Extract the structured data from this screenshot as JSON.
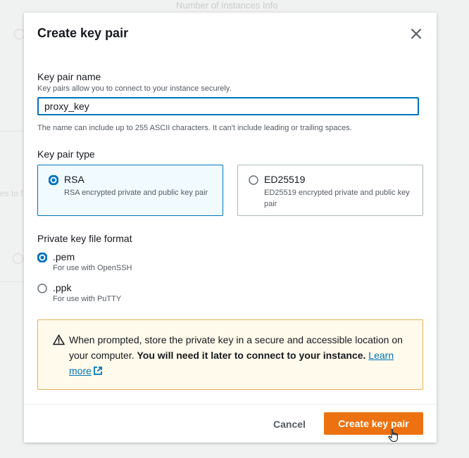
{
  "background": {
    "top_text": "Number of instances    Info",
    "left_text": "es to f"
  },
  "modal": {
    "title": "Create key pair",
    "close_icon": "close-icon"
  },
  "key_pair_name": {
    "label": "Key pair name",
    "description": "Key pairs allow you to connect to your instance securely.",
    "value": "proxy_key",
    "hint": "The name can include up to 255 ASCII characters. It can't include leading or trailing spaces."
  },
  "key_pair_type": {
    "label": "Key pair type",
    "options": [
      {
        "title": "RSA",
        "description": "RSA encrypted private and public key pair",
        "selected": true
      },
      {
        "title": "ED25519",
        "description": "ED25519 encrypted private and public key pair",
        "selected": false
      }
    ]
  },
  "private_key_format": {
    "label": "Private key file format",
    "options": [
      {
        "title": ".pem",
        "description": "For use with OpenSSH",
        "selected": true
      },
      {
        "title": ".ppk",
        "description": "For use with PuTTY",
        "selected": false
      }
    ]
  },
  "alert": {
    "icon": "warning-icon",
    "text": "When prompted, store the private key in a secure and accessible location on your computer. ",
    "bold_text": "You will need it later to connect to your instance.",
    "link_text": "Learn more",
    "link_icon": "external-link-icon"
  },
  "footer": {
    "cancel_label": "Cancel",
    "primary_label": "Create key pair"
  },
  "colors": {
    "accent": "#0073bb",
    "primary_button": "#ec7211",
    "alert_border": "#e6b35a",
    "alert_background": "#fffaeb"
  }
}
